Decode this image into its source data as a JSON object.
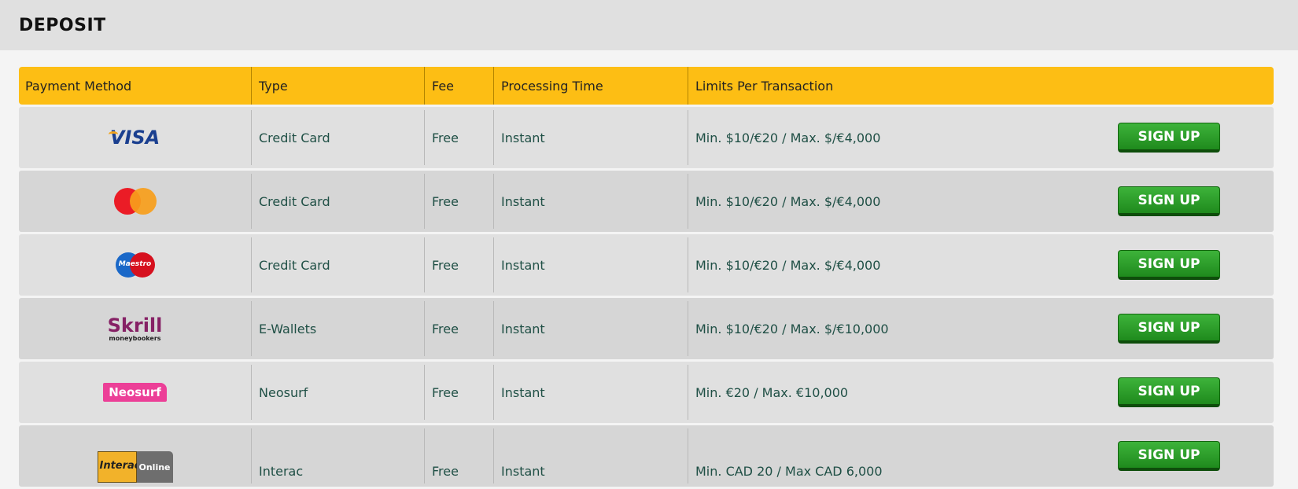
{
  "page": {
    "title": "DEPOSIT"
  },
  "table": {
    "headers": [
      "Payment Method",
      "Type",
      "Fee",
      "Processing Time",
      "Limits Per Transaction"
    ],
    "rows": [
      {
        "logo": "visa-logo",
        "logo_text": "VISA",
        "type": "Credit Card",
        "fee": "Free",
        "time": "Instant",
        "limits": "Min. $10/€20 / Max. $/€4,000",
        "button": "SIGN UP"
      },
      {
        "logo": "mastercard-logo",
        "type": "Credit Card",
        "fee": "Free",
        "time": "Instant",
        "limits": "Min. $10/€20 / Max. $/€4,000",
        "button": "SIGN UP"
      },
      {
        "logo": "maestro-logo",
        "logo_text": "Maestro",
        "type": "Credit Card",
        "fee": "Free",
        "time": "Instant",
        "limits": "Min. $10/€20 / Max. $/€4,000",
        "button": "SIGN UP"
      },
      {
        "logo": "skrill-logo",
        "logo_text": "Skrill",
        "logo_subtext": "moneybookers",
        "type": "E-Wallets",
        "fee": "Free",
        "time": "Instant",
        "limits": "Min. $10/€20 / Max. $/€10,000",
        "button": "SIGN UP"
      },
      {
        "logo": "neosurf-logo",
        "logo_text": "Neosurf",
        "type": "Neosurf",
        "fee": "Free",
        "time": "Instant",
        "limits": "Min. €20 / Max. €10,000",
        "button": "SIGN UP"
      },
      {
        "logo": "interac-logo",
        "logo_text": "Interac",
        "logo_subtext": "Online",
        "type": "Interac",
        "fee": "Free",
        "time": "Instant",
        "limits": "Min. CAD 20 / Max CAD 6,000",
        "button": "SIGN UP"
      }
    ]
  },
  "colors": {
    "header_bar": "#fdbe14",
    "button": "#2a9d27",
    "row_text": "#1f4f45"
  }
}
